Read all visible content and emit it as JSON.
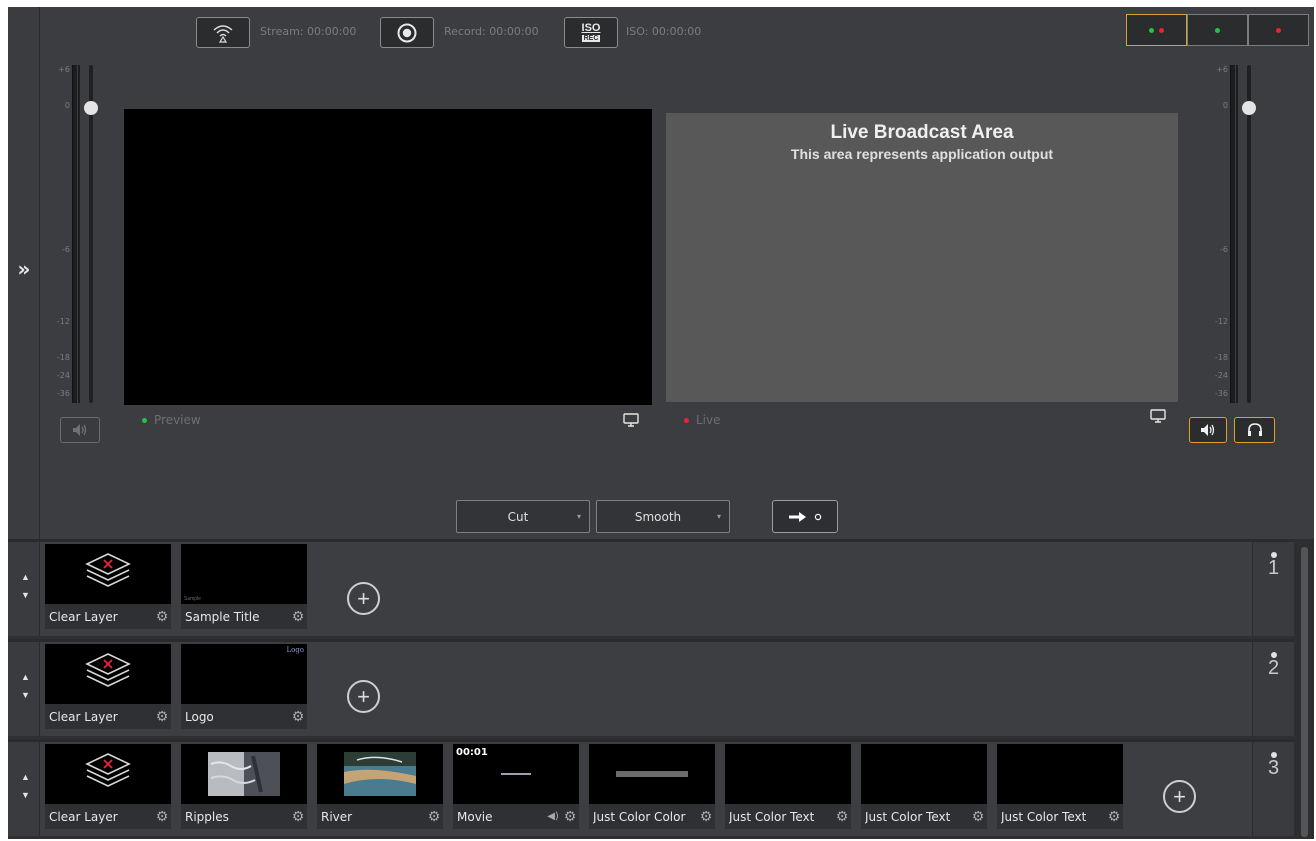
{
  "top_bar": {
    "stream_label": "Stream: 00:00:00",
    "record_label": "Record: 00:00:00",
    "iso_label": "ISO: 00:00:00",
    "iso_icon_text": "ISO",
    "iso_icon_sub": "REC"
  },
  "layout_selector": [
    "preview-and-live",
    "preview-only",
    "live-only"
  ],
  "meter_ticks": [
    "+6",
    "0",
    "-6",
    "-12",
    "-18",
    "-24",
    "-36"
  ],
  "monitors": {
    "preview_label": "Preview",
    "live_label": "Live",
    "live_title": "Live Broadcast Area",
    "live_subtitle": "This area represents application output"
  },
  "transitions": {
    "cut_label": "Cut",
    "smooth_label": "Smooth"
  },
  "layers": [
    {
      "number": "1",
      "inputs": [
        {
          "name": "Clear Layer",
          "type": "clear-layer"
        },
        {
          "name": "Sample Title",
          "type": "title",
          "thumb_text": "Sample"
        }
      ]
    },
    {
      "number": "2",
      "inputs": [
        {
          "name": "Clear Layer",
          "type": "clear-layer"
        },
        {
          "name": "Logo",
          "type": "logo",
          "thumb_text": "Logo"
        }
      ]
    },
    {
      "number": "3",
      "inputs": [
        {
          "name": "Clear Layer",
          "type": "clear-layer"
        },
        {
          "name": "Ripples",
          "type": "image"
        },
        {
          "name": "River",
          "type": "image"
        },
        {
          "name": "Movie",
          "type": "movie",
          "timecode": "00:01"
        },
        {
          "name": "Just Color Color",
          "type": "color-bar"
        },
        {
          "name": "Just Color Text",
          "type": "blank"
        },
        {
          "name": "Just Color Text",
          "type": "blank"
        },
        {
          "name": "Just Color Text",
          "type": "blank"
        }
      ]
    }
  ],
  "colors": {
    "accent_gold": "#e0a020",
    "live_dot": "#e8233a",
    "preview_dot": "#22c53d"
  }
}
